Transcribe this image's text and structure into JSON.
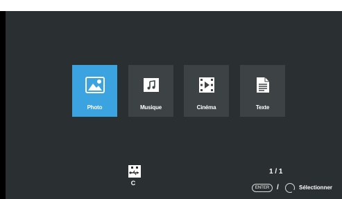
{
  "menu": {
    "items": [
      {
        "label": "Photo",
        "icon": "photo-icon"
      },
      {
        "label": "Musique",
        "icon": "music-icon"
      },
      {
        "label": "Cinéma",
        "icon": "film-icon"
      },
      {
        "label": "Texte",
        "icon": "document-icon"
      }
    ],
    "selected_index": 0
  },
  "device": {
    "icon": "usb-drive-icon",
    "drive_label": "C"
  },
  "pagination": {
    "text": "1 / 1"
  },
  "hint": {
    "enter_key": "ENTER",
    "separator": "/",
    "action": "Sélectionner"
  },
  "colors": {
    "background": "#2a2f32",
    "tile": "#3d4245",
    "selected": "#3aa3e0"
  }
}
